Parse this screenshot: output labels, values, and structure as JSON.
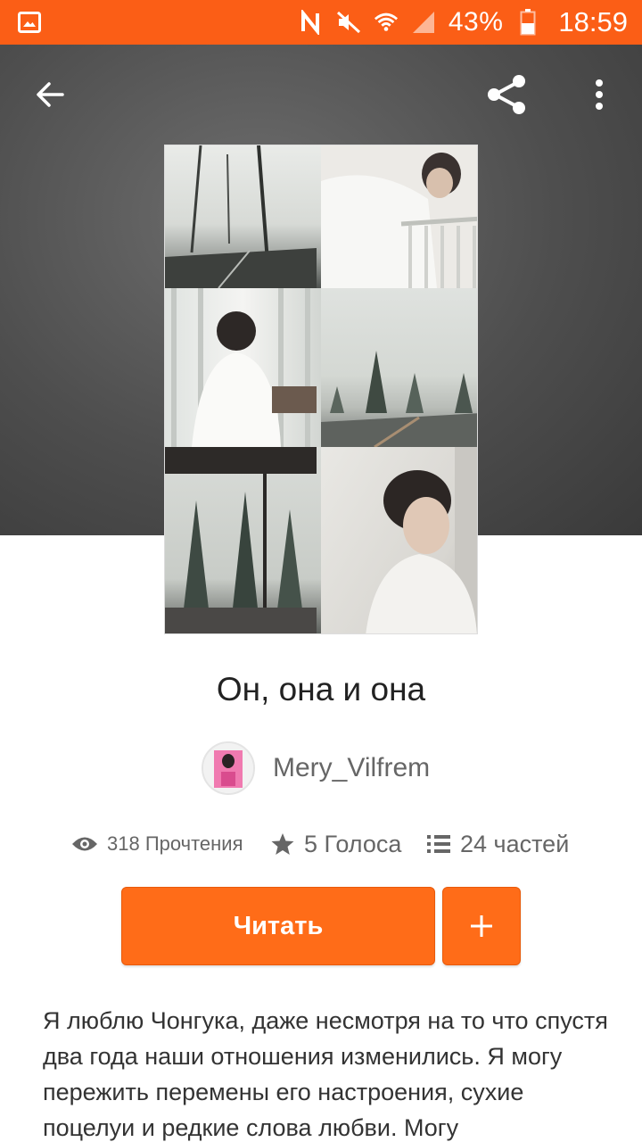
{
  "status_bar": {
    "battery_percent": "43%",
    "time": "18:59",
    "background_color": "#fb5e16",
    "icons": [
      "gallery-notification-icon",
      "nfc-icon",
      "mute-icon",
      "wifi-icon",
      "signal-icon",
      "battery-icon"
    ]
  },
  "toolbar": {
    "icons": [
      "back-arrow-icon",
      "share-icon",
      "more-vert-icon"
    ]
  },
  "story": {
    "title": "Он, она и она",
    "author": "Mery_Vilfrem",
    "stats": {
      "reads": "318 Прочтения",
      "votes": "5 Голоса",
      "parts": "24 частей"
    },
    "description": "Я люблю Чонгука, даже несмотря на то что спустя два года наши отношения изменились. Я могу пережить перемены его настроения, сухие поцелуи и редкие слова любви. Могу"
  },
  "actions": {
    "read_label": "Читать",
    "add_label": "+",
    "accent_color": "#ff6c18"
  }
}
